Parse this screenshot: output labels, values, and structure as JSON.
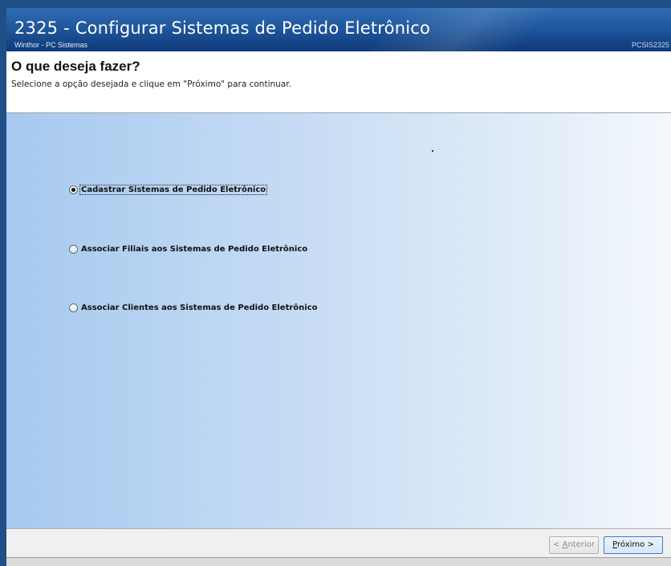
{
  "window": {
    "title": "2325 - Configurar Sistemas de Pedido Eletrônico",
    "subtitle": "Winthor - PC Sistemas",
    "code": "PCSIS2325"
  },
  "header": {
    "title": "O que deseja fazer?",
    "description": "Selecione a opção desejada e clique em \"Próximo\" para continuar."
  },
  "options": [
    {
      "label": "Cadastrar Sistemas de Pedido Eletrônico",
      "selected": true
    },
    {
      "label": "Associar Filiais aos Sistemas de Pedido Eletrônico",
      "selected": false
    },
    {
      "label": "Associar Clientes aos Sistemas de Pedido Eletrônico",
      "selected": false
    }
  ],
  "footer": {
    "previous_label_prefix": "< ",
    "previous_label_accel": "A",
    "previous_label_rest": "nterior",
    "next_label_accel": "P",
    "next_label_rest": "róximo >"
  },
  "colors": {
    "titlebar": "#1d5298",
    "content_gradient_start": "#a7c9ef",
    "content_gradient_end": "#f4f8fc"
  }
}
